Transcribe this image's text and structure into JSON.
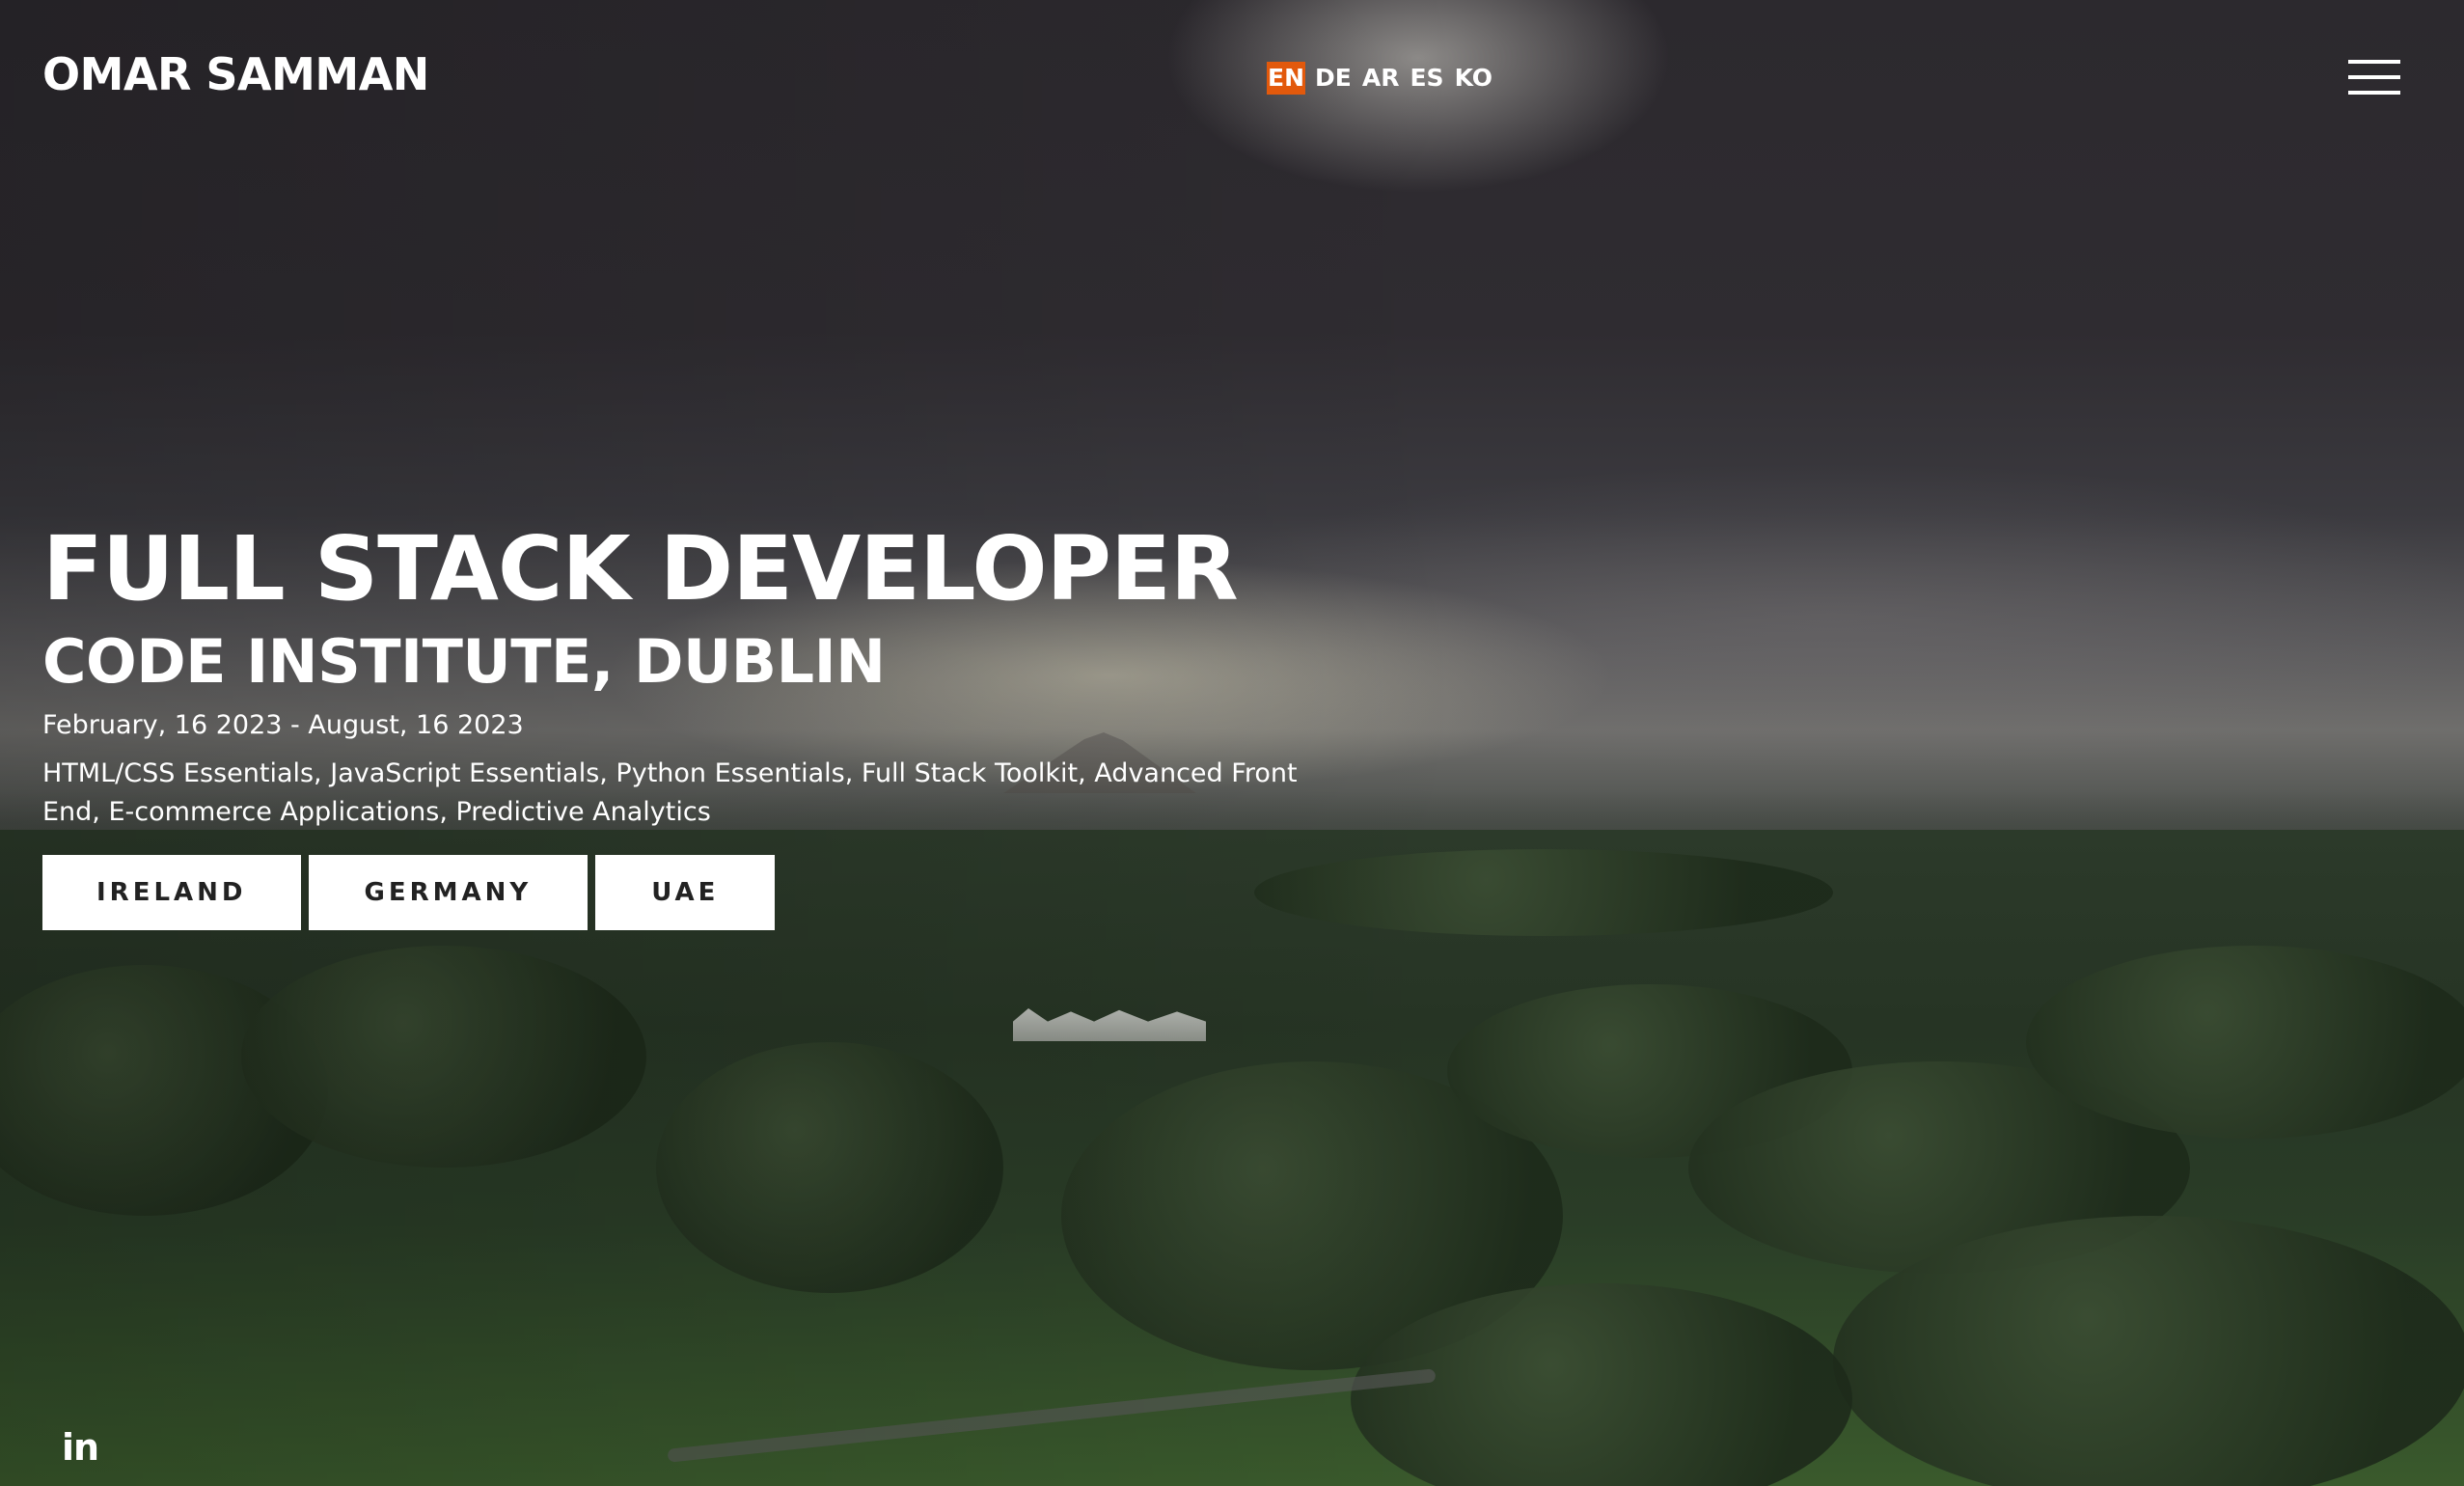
{
  "header": {
    "brand": "OMAR SAMMAN",
    "languages": [
      {
        "code": "EN",
        "active": true
      },
      {
        "code": "DE",
        "active": false
      },
      {
        "code": "AR",
        "active": false
      },
      {
        "code": "ES",
        "active": false
      },
      {
        "code": "KO",
        "active": false
      }
    ],
    "menu_icon": "hamburger-menu-icon"
  },
  "hero": {
    "headline": "FULL STACK DEVELOPER",
    "subheadline": "CODE INSTITUTE, DUBLIN",
    "dates": "February, 16 2023 - August, 16 2023",
    "courses": "HTML/CSS Essentials, JavaScript Essentials, Python Essentials, Full Stack Toolkit, Advanced Front End, E-commerce Applications, Predictive Analytics",
    "countries": [
      "IRELAND",
      "GERMANY",
      "UAE"
    ]
  },
  "social": {
    "linkedin_icon": "linkedin-icon",
    "linkedin_glyph": "in"
  },
  "colors": {
    "accent": "#e2590c",
    "text": "#ffffff",
    "button_bg": "#ffffff",
    "button_text": "#222222"
  }
}
